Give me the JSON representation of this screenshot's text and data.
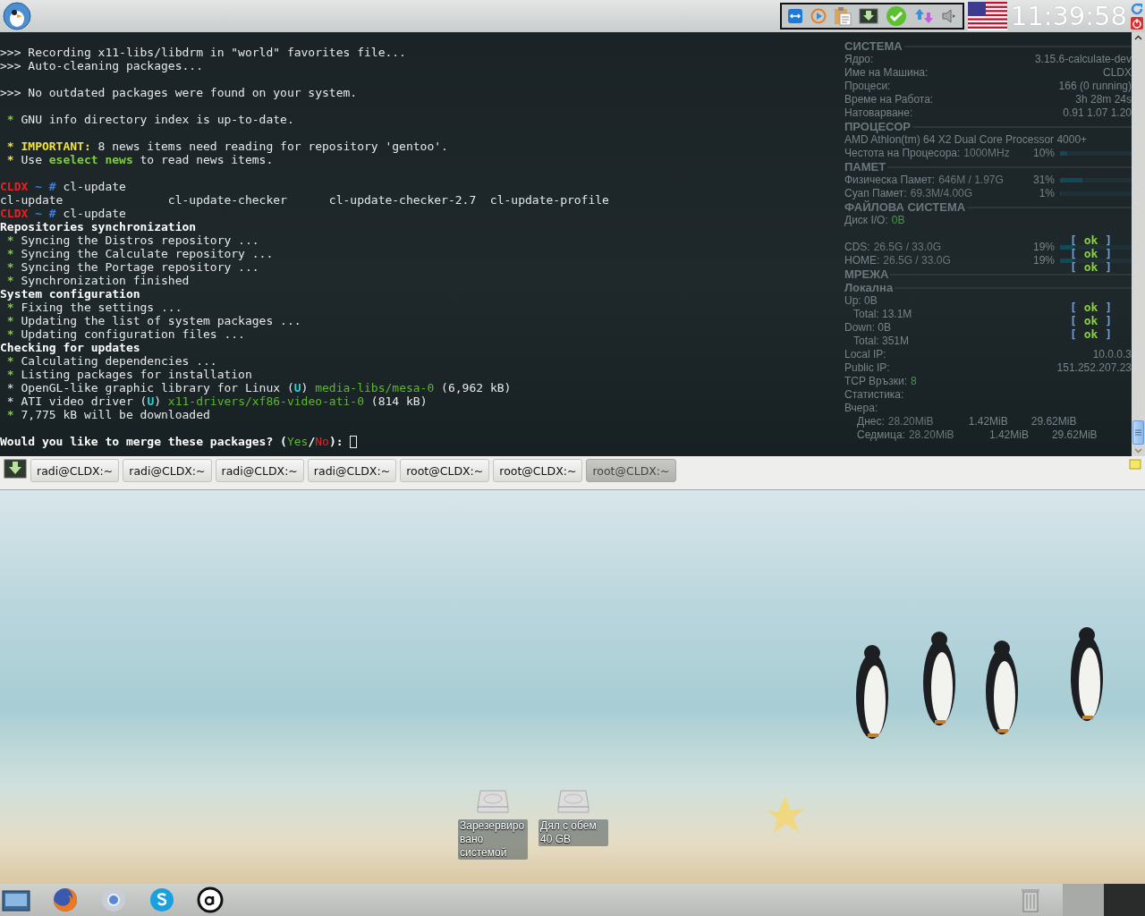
{
  "top_bar": {
    "clock": "11:39:58"
  },
  "terminal": {
    "lines": [
      {
        "segments": [
          {
            "kind": "plain",
            "text": ">>> Recording x11-libs/libdrm in \"world\" favorites file..."
          }
        ]
      },
      {
        "segments": [
          {
            "kind": "plain",
            "text": ">>> Auto-cleaning packages..."
          }
        ]
      },
      {
        "kind": "blank"
      },
      {
        "segments": [
          {
            "kind": "plain",
            "text": ">>> No outdated packages were found on your system."
          }
        ]
      },
      {
        "kind": "blank"
      },
      {
        "segments": [
          {
            "kind": "star",
            "text": " * "
          },
          {
            "kind": "plain",
            "text": "GNU info directory index is up-to-date."
          }
        ]
      },
      {
        "kind": "blank"
      },
      {
        "segments": [
          {
            "kind": "important",
            "text": " * IMPORTANT:"
          },
          {
            "kind": "plain",
            "text": " 8 news items need reading for repository 'gentoo'."
          }
        ]
      },
      {
        "segments": [
          {
            "kind": "important",
            "text": " * "
          },
          {
            "kind": "plain",
            "text": "Use "
          },
          {
            "kind": "highlight",
            "text": "eselect news"
          },
          {
            "kind": "plain",
            "text": " to read news items."
          }
        ]
      },
      {
        "kind": "blank"
      },
      {
        "segments": [
          {
            "kind": "host",
            "text": "CLDX"
          },
          {
            "kind": "path",
            "text": " ~ # "
          },
          {
            "kind": "plain",
            "text": "cl-update"
          }
        ]
      },
      {
        "segments": [
          {
            "kind": "plain",
            "text": "cl-update               cl-update-checker      cl-update-checker-2.7  cl-update-profile"
          }
        ]
      },
      {
        "segments": [
          {
            "kind": "host",
            "text": "CLDX"
          },
          {
            "kind": "path",
            "text": " ~ # "
          },
          {
            "kind": "plain",
            "text": "cl-update"
          }
        ]
      },
      {
        "segments": [
          {
            "kind": "bold",
            "text": "Repositories synchronization"
          }
        ]
      },
      {
        "segments": [
          {
            "kind": "star",
            "text": " * "
          },
          {
            "kind": "plain",
            "text": "Syncing the Distros repository ..."
          }
        ],
        "status": [
          "[",
          "ok",
          "]"
        ]
      },
      {
        "segments": [
          {
            "kind": "star",
            "text": " * "
          },
          {
            "kind": "plain",
            "text": "Syncing the Calculate repository ..."
          }
        ],
        "status": [
          "[",
          "ok",
          "]"
        ]
      },
      {
        "segments": [
          {
            "kind": "star",
            "text": " * "
          },
          {
            "kind": "plain",
            "text": "Syncing the Portage repository ..."
          }
        ],
        "status": [
          "[",
          "ok",
          "]"
        ]
      },
      {
        "segments": [
          {
            "kind": "star",
            "text": " * "
          },
          {
            "kind": "plain",
            "text": "Synchronization finished"
          }
        ]
      },
      {
        "segments": [
          {
            "kind": "bold",
            "text": "System configuration"
          }
        ]
      },
      {
        "segments": [
          {
            "kind": "star",
            "text": " * "
          },
          {
            "kind": "plain",
            "text": "Fixing the settings ..."
          }
        ],
        "status": [
          "[",
          "ok",
          "]"
        ]
      },
      {
        "segments": [
          {
            "kind": "star",
            "text": " * "
          },
          {
            "kind": "plain",
            "text": "Updating the list of system packages ..."
          }
        ],
        "status": [
          "[",
          "ok",
          "]"
        ]
      },
      {
        "segments": [
          {
            "kind": "star",
            "text": " * "
          },
          {
            "kind": "plain",
            "text": "Updating configuration files ..."
          }
        ],
        "status": [
          "[",
          "ok",
          "]"
        ]
      },
      {
        "segments": [
          {
            "kind": "bold",
            "text": "Checking for updates"
          }
        ]
      },
      {
        "segments": [
          {
            "kind": "star",
            "text": " * "
          },
          {
            "kind": "plain",
            "text": "Calculating dependencies ..."
          }
        ]
      },
      {
        "segments": [
          {
            "kind": "star",
            "text": " * "
          },
          {
            "kind": "plain",
            "text": "Listing packages for installation"
          }
        ]
      },
      {
        "segments": [
          {
            "kind": "plain",
            "text": " * OpenGL-like graphic library for Linux ("
          },
          {
            "kind": "flag",
            "text": "U"
          },
          {
            "kind": "plain",
            "text": ") "
          },
          {
            "kind": "package",
            "text": "media-libs/mesa-0"
          },
          {
            "kind": "plain",
            "text": " (6,962 kB)"
          }
        ]
      },
      {
        "segments": [
          {
            "kind": "plain",
            "text": " * ATI video driver ("
          },
          {
            "kind": "flag",
            "text": "U"
          },
          {
            "kind": "plain",
            "text": ") "
          },
          {
            "kind": "package",
            "text": "x11-drivers/xf86-video-ati-0"
          },
          {
            "kind": "plain",
            "text": " (814 kB)"
          }
        ]
      },
      {
        "segments": [
          {
            "kind": "star",
            "text": " * "
          },
          {
            "kind": "plain",
            "text": "7,775 kB will be downloaded"
          }
        ]
      },
      {
        "kind": "blank"
      },
      {
        "segments": [
          {
            "kind": "bold",
            "text": "Would you like to merge these packages? ("
          },
          {
            "kind": "yes",
            "text": "Yes"
          },
          {
            "kind": "bold",
            "text": "/"
          },
          {
            "kind": "no",
            "text": "No"
          },
          {
            "kind": "bold",
            "text": "): "
          }
        ],
        "cursor": true
      }
    ],
    "monitor": [
      {
        "kind": "heading",
        "label": "СИСТЕМА"
      },
      {
        "kind": "row",
        "label": "Ядро:",
        "value": "3.15.6-calculate-dev"
      },
      {
        "kind": "row",
        "label": "Име на Машина:",
        "value": "CLDX"
      },
      {
        "kind": "row",
        "label": "Процеси:",
        "value": "166 (0 running)"
      },
      {
        "kind": "row",
        "label": "Време на Работа:",
        "value": "3h 28m 24s"
      },
      {
        "kind": "row",
        "label": "Натоварване:",
        "value": "0.91 1.07 1.20"
      },
      {
        "kind": "heading",
        "label": "ПРОЦЕСОР"
      },
      {
        "kind": "text",
        "label": "AMD Athlon(tm) 64 X2 Dual Core Processor 4000+"
      },
      {
        "kind": "meter",
        "label": "Честота на Процесора:",
        "value": "1000MHz",
        "percent": "10%",
        "level": 0.1
      },
      {
        "kind": "heading",
        "label": "ПАМЕТ"
      },
      {
        "kind": "meter",
        "label": "Физическа Памет:",
        "value": "646M / 1.97G",
        "percent": "31%",
        "level": 0.31
      },
      {
        "kind": "meter",
        "label": "Суап Памет:",
        "value": "69.3M/4.00G",
        "percent": "1%",
        "level": 0.01
      },
      {
        "kind": "heading",
        "label": "ФАЙЛОВА СИСТЕМА"
      },
      {
        "kind": "io",
        "label": "Диск I/O:",
        "value": "0B"
      },
      {
        "kind": "gap"
      },
      {
        "kind": "meter",
        "label": "CDS:",
        "value": "26.5G / 33.0G",
        "percent": "19%",
        "level": 0.19
      },
      {
        "kind": "meter",
        "label": "HOME:",
        "value": "26.5G / 33.0G",
        "percent": "19%",
        "level": 0.19
      },
      {
        "kind": "heading",
        "label": "МРЕЖА"
      },
      {
        "kind": "heading",
        "label": "Локална"
      },
      {
        "kind": "net",
        "label": "Up: 0B",
        "value": "Total: 13.1M"
      },
      {
        "kind": "net",
        "label": "Down: 0B",
        "value": "Total: 351M"
      },
      {
        "kind": "row",
        "label": "Local IP:",
        "value": "10.0.0.3"
      },
      {
        "kind": "row",
        "label": "Public IP:",
        "value": "151.252.207.23"
      },
      {
        "kind": "io",
        "label": "TCP Връзки:",
        "value": "8"
      },
      {
        "kind": "text",
        "label": "Статистика:"
      },
      {
        "kind": "text",
        "label": "Вчера:"
      },
      {
        "kind": "stat",
        "label": "Днес:",
        "value": "28.20MiB",
        "up": "1.42MiB",
        "total": "29.62MiB"
      },
      {
        "kind": "stat",
        "label": "Седмица:",
        "value": "28.20MiB",
        "up": "1.42MiB",
        "total": "29.62MiB"
      }
    ]
  },
  "tabs": [
    {
      "label": "radi@CLDX:~",
      "selected": false
    },
    {
      "label": "radi@CLDX:~",
      "selected": false
    },
    {
      "label": "radi@CLDX:~",
      "selected": false
    },
    {
      "label": "radi@CLDX:~",
      "selected": false
    },
    {
      "label": "root@CLDX:~",
      "selected": false
    },
    {
      "label": "root@CLDX:~",
      "selected": false
    },
    {
      "label": "root@CLDX:~",
      "selected": true
    }
  ],
  "desktop_icons": [
    {
      "label": "Зарезервировано системой"
    },
    {
      "label": "Дял с обем 40 GB"
    }
  ],
  "pager": [
    {
      "selected": true
    },
    {
      "selected": false
    }
  ]
}
